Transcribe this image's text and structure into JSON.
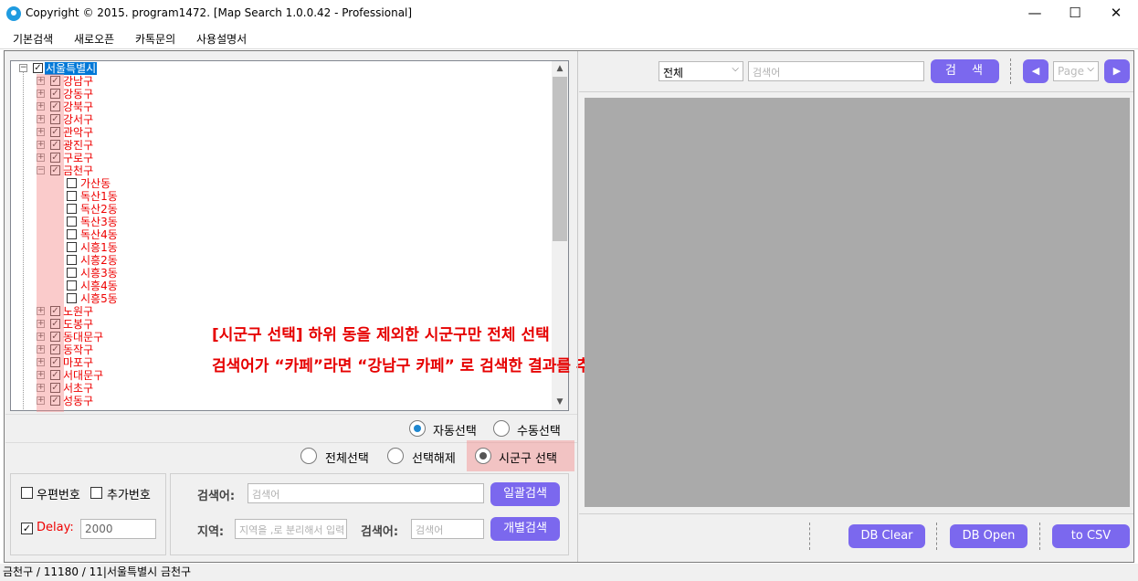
{
  "window": {
    "title": "Copyright © 2015. program1472. [Map Search 1.0.0.42 - Professional]",
    "minimize": "—",
    "maximize": "☐",
    "close": "✕"
  },
  "menu": [
    "기본검색",
    "새로오픈",
    "카톡문의",
    "사용설명서"
  ],
  "tree": {
    "root": "서울특별시",
    "items": [
      {
        "label": "강남구",
        "level": 1,
        "checked": true,
        "expander": "+"
      },
      {
        "label": "강동구",
        "level": 1,
        "checked": true,
        "expander": "+"
      },
      {
        "label": "강북구",
        "level": 1,
        "checked": true,
        "expander": "+"
      },
      {
        "label": "강서구",
        "level": 1,
        "checked": true,
        "expander": "+"
      },
      {
        "label": "관악구",
        "level": 1,
        "checked": true,
        "expander": "+"
      },
      {
        "label": "광진구",
        "level": 1,
        "checked": true,
        "expander": "+"
      },
      {
        "label": "구로구",
        "level": 1,
        "checked": true,
        "expander": "+"
      },
      {
        "label": "금천구",
        "level": 1,
        "checked": true,
        "expander": "−"
      },
      {
        "label": "가산동",
        "level": 2,
        "checked": false
      },
      {
        "label": "독산1동",
        "level": 2,
        "checked": false
      },
      {
        "label": "독산2동",
        "level": 2,
        "checked": false
      },
      {
        "label": "독산3동",
        "level": 2,
        "checked": false
      },
      {
        "label": "독산4동",
        "level": 2,
        "checked": false
      },
      {
        "label": "시흥1동",
        "level": 2,
        "checked": false
      },
      {
        "label": "시흥2동",
        "level": 2,
        "checked": false
      },
      {
        "label": "시흥3동",
        "level": 2,
        "checked": false
      },
      {
        "label": "시흥4동",
        "level": 2,
        "checked": false
      },
      {
        "label": "시흥5동",
        "level": 2,
        "checked": false
      },
      {
        "label": "노원구",
        "level": 1,
        "checked": true,
        "expander": "+"
      },
      {
        "label": "도봉구",
        "level": 1,
        "checked": true,
        "expander": "+"
      },
      {
        "label": "동대문구",
        "level": 1,
        "checked": true,
        "expander": "+"
      },
      {
        "label": "동작구",
        "level": 1,
        "checked": true,
        "expander": "+"
      },
      {
        "label": "마포구",
        "level": 1,
        "checked": true,
        "expander": "+"
      },
      {
        "label": "서대문구",
        "level": 1,
        "checked": true,
        "expander": "+"
      },
      {
        "label": "서초구",
        "level": 1,
        "checked": true,
        "expander": "+"
      },
      {
        "label": "성동구",
        "level": 1,
        "checked": true,
        "expander": "+"
      }
    ]
  },
  "annotation": {
    "line1": "[시군구 선택] 하위 동을 제외한 시군구만 전체 선택",
    "line2": "검색어가 “카페”라면 “강남구 카페” 로 검색한 결과를 추출합니다."
  },
  "mode_radios": {
    "auto": "자동선택",
    "manual": "수동선택",
    "selected": "auto"
  },
  "select_radios": {
    "all": "전체선택",
    "none": "선택해제",
    "sigungu": "시군구 선택",
    "selected": "sigungu"
  },
  "options": {
    "postal": "우편번호",
    "extra": "추가번호",
    "delay_label": "Delay:",
    "delay_value": "2000",
    "delay_checked": true
  },
  "search_box": {
    "keyword_label": "검색어:",
    "keyword_placeholder": "검색어",
    "bulk_button": "일괄검색",
    "region_label": "지역:",
    "region_placeholder": "지역을 ,로 분리해서 입력",
    "keyword2_label": "검색어:",
    "keyword2_placeholder": "검색어",
    "individual_button": "개별검색"
  },
  "right_toolbar": {
    "category": "전체",
    "search_placeholder": "검색어",
    "search_button": "검　색",
    "page_placeholder": "Page",
    "prev": "◀",
    "next": "▶"
  },
  "bottom_buttons": {
    "db_clear": "DB Clear",
    "db_open": "DB Open",
    "to_csv": "to CSV"
  },
  "status": "금천구 / 11180 / 11|서울특별시 금천구",
  "colors": {
    "accent": "#7b68ee",
    "tree_text": "#e00000",
    "annotation": "#e60000",
    "map_bg": "#aaaaaa"
  }
}
